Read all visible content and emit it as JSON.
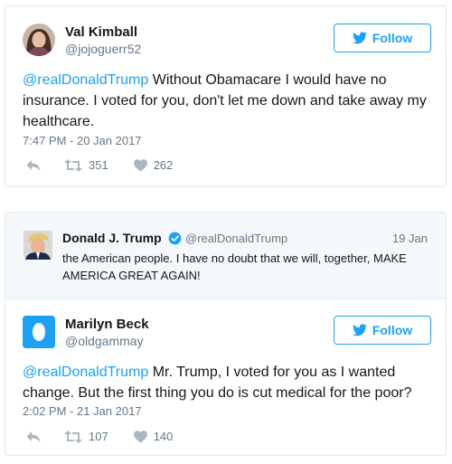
{
  "tweets": [
    {
      "name": "Val Kimball",
      "handle": "@jojoguerr52",
      "follow_label": "Follow",
      "mention": "@realDonaldTrump",
      "body": " Without Obamacare I would have no insurance. I voted for you, don't let me down and take away my healthcare.",
      "timestamp": "7:47 PM - 20 Jan 2017",
      "retweets": "351",
      "likes": "262"
    },
    {
      "name": "Marilyn Beck",
      "handle": "@oldgammay",
      "follow_label": "Follow",
      "mention": "@realDonaldTrump",
      "body": " Mr. Trump, I voted for you as I wanted change. But the first thing you do is cut medical for the poor?",
      "timestamp": "2:02 PM - 21 Jan 2017",
      "retweets": "107",
      "likes": "140"
    }
  ],
  "quoted_tweet": {
    "name": "Donald J. Trump",
    "handle": "@realDonaldTrump",
    "date": "19 Jan",
    "text": "the American people. I have no doubt that we will, together, MAKE AMERICA GREAT AGAIN!"
  },
  "colors": {
    "accent": "#1da1f2",
    "muted": "#657786",
    "border": "#e1e8ed",
    "quoted_bg": "#f5f8fa"
  },
  "icons": [
    "twitter-bird-icon",
    "reply-icon",
    "retweet-icon",
    "heart-icon",
    "verified-badge-icon"
  ]
}
